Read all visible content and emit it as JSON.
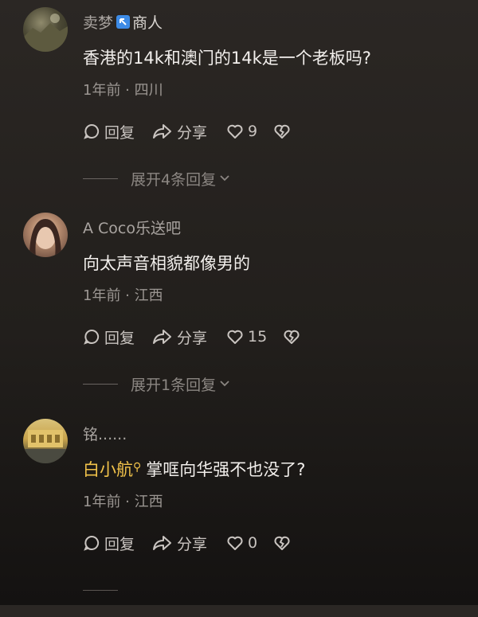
{
  "comments": [
    {
      "avatar": "landscape-avatar",
      "username": "卖梦",
      "badge_icon": "arrow-up-left-icon",
      "tag": "商人",
      "text": "香港的14k和澳门的14k是一个老板吗?",
      "meta": "1年前 · 四川",
      "reply_label": "回复",
      "share_label": "分享",
      "like_count": "9",
      "expand_label": "展开4条回复"
    },
    {
      "avatar": "woman-portrait-avatar",
      "username": "A Coco乐送吧",
      "text": "向太声音相貌都像男的",
      "meta": "1年前 · 江西",
      "reply_label": "回复",
      "share_label": "分享",
      "like_count": "15",
      "expand_label": "展开1条回复"
    },
    {
      "avatar": "building-avatar",
      "username": "铭......",
      "mention": "白小航",
      "mention_icon": "search-icon",
      "text": "掌哐向华强不也没了?",
      "meta": "1年前 · 江西",
      "reply_label": "回复",
      "share_label": "分享",
      "like_count": "0"
    }
  ],
  "colors": {
    "background": "#221f1c",
    "badge": "#3d8be6",
    "mention": "#f1c24a"
  }
}
